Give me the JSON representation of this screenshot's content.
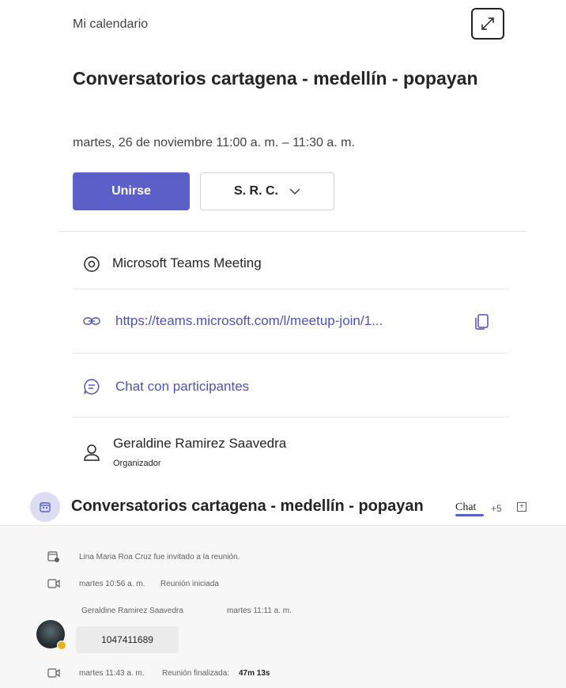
{
  "calendar": {
    "label": "Mi calendario"
  },
  "meeting": {
    "title": "Conversatorios cartagena - medellín - popayan",
    "time": "martes, 26 de noviembre 11:00 a. m. – 11:30 a. m.",
    "join_label": "Unirse",
    "rsvp_label": "S. R. C.",
    "location": "Microsoft Teams Meeting",
    "link": "https://teams.microsoft.com/l/meetup-join/1...",
    "chat_label": "Chat con participantes",
    "organizer_name": "Geraldine Ramirez Saavedra",
    "organizer_role": "Organizador"
  },
  "chat": {
    "title": "Conversatorios cartagena - medellín - popayan",
    "tab_label": "Chat",
    "extra_tabs": "+5",
    "events": [
      {
        "text": "Lina Maria Roa Cruz fue invitado a la reunión."
      },
      {
        "time": "martes 10:56 a. m.",
        "text": "Reunión iniciada"
      }
    ],
    "message": {
      "sender": "Geraldine Ramirez Saavedra",
      "time": "martes 11:11 a. m.",
      "text": "1047411689"
    },
    "end_event": {
      "time": "martes 11:43 a. m.",
      "text": "Reunión finalizada:",
      "duration": "47m 13s"
    }
  },
  "colors": {
    "accent": "#5b5fc7",
    "link": "#4f52b2",
    "presence": "#e8b11a"
  }
}
